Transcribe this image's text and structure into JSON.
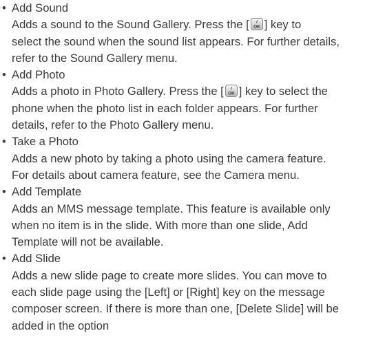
{
  "items": [
    {
      "title": "Add Sound",
      "lines": [
        [
          "Adds a sound to the Sound Gallery. Press the [",
          "ok",
          "] key to"
        ],
        [
          "select the sound when the sound list appears. For further details,"
        ],
        [
          "refer to the Sound Gallery menu."
        ]
      ]
    },
    {
      "title": "Add Photo",
      "lines": [
        [
          "Adds a photo in Photo Gallery. Press the [",
          "ok",
          "] key to select the"
        ],
        [
          "phone when the photo list in each folder appears. For further"
        ],
        [
          "details, refer to the Photo Gallery menu."
        ]
      ]
    },
    {
      "title": "Take a Photo",
      "lines": [
        [
          "Adds a new photo by taking a photo using the camera feature."
        ],
        [
          "For details about camera feature, see the Camera menu."
        ]
      ]
    },
    {
      "title": "Add Template",
      "lines": [
        [
          "Adds an MMS message template. This feature is available only"
        ],
        [
          "when no item is in the slide. With more than one slide, Add"
        ],
        [
          "Template will not be available."
        ]
      ]
    },
    {
      "title": "Add Slide",
      "lines": [
        [
          "Adds a new slide page to create more slides. You can  move to"
        ],
        [
          "each slide page using the [Left] or [Right] key on the message"
        ],
        [
          "composer screen. If there is more than one, [Delete Slide] will be"
        ],
        [
          "added in the option"
        ]
      ]
    }
  ],
  "bullet_char": "•",
  "ok_key_icon": "ok-key-icon"
}
